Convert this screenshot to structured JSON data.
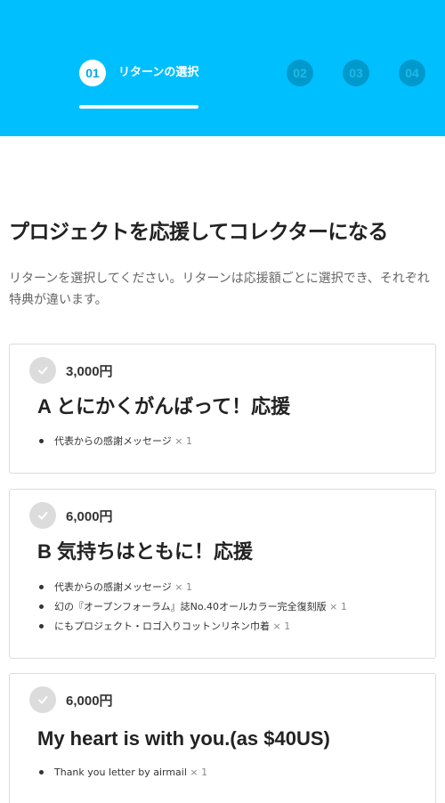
{
  "steps": {
    "active": {
      "number": "01",
      "label": "リターンの選択"
    },
    "inactive": [
      "02",
      "03",
      "04"
    ]
  },
  "page_title": "プロジェクトを応援してコレクターになる",
  "intro": "リターンを選択してください。リターンは応援額ごとに選択でき、それぞれ特典が違います。",
  "rewards": [
    {
      "price": "3,000円",
      "title": "A とにかくがんばって！応援",
      "items": [
        {
          "text": "代表からの感謝メッセージ",
          "mult": "× 1"
        }
      ]
    },
    {
      "price": "6,000円",
      "title": "B 気持ちはともに！応援",
      "items": [
        {
          "text": "代表からの感謝メッセージ",
          "mult": "× 1"
        },
        {
          "text": "幻の『オープンフォーラム』誌No.40オールカラー完全復刻版",
          "mult": "× 1"
        },
        {
          "text": "にもプロジェクト・ロゴ入りコットンリネン巾着",
          "mult": "× 1"
        }
      ]
    },
    {
      "price": "6,000円",
      "title": "My heart is with you.(as $40US)",
      "items": [
        {
          "text": "Thank you letter by airmail",
          "mult": "× 1"
        }
      ]
    }
  ],
  "colors": {
    "header": "#00bfff",
    "step_inactive": "#0099cc",
    "check": "#dcdcdc"
  },
  "icons": {
    "check": "check-icon"
  }
}
